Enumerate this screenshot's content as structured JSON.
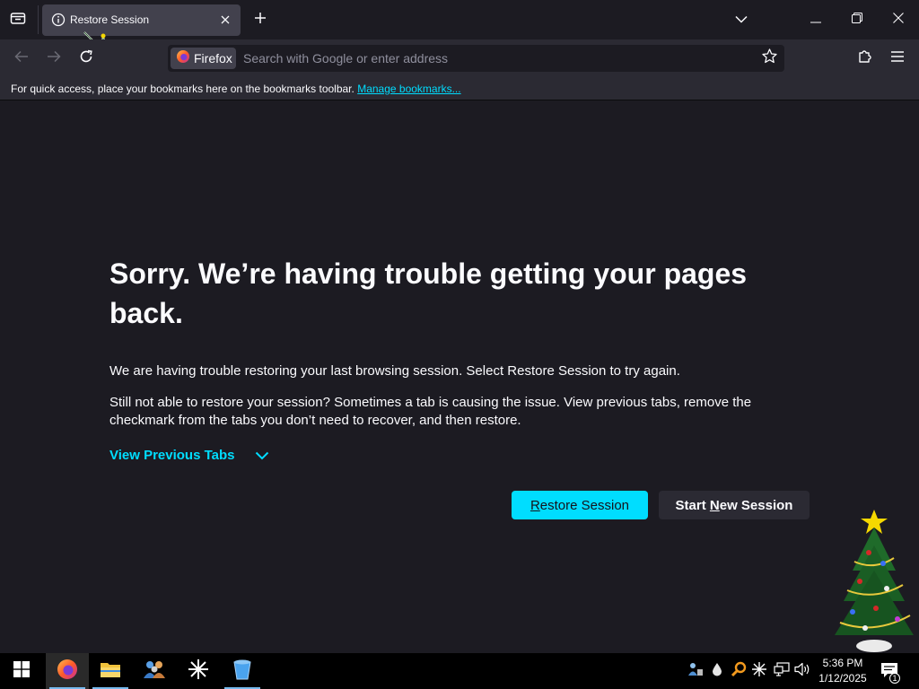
{
  "browser": {
    "tab": {
      "title": "Restore Session"
    },
    "urlbar": {
      "identity_label": "Firefox",
      "placeholder": "Search with Google or enter address",
      "value": ""
    },
    "bookmarks_bar": {
      "message": "For quick access, place your bookmarks here on the bookmarks toolbar.",
      "link": "Manage bookmarks..."
    }
  },
  "page": {
    "heading": "Sorry. We’re having trouble getting your pages back.",
    "paragraph1": "We are having trouble restoring your last browsing session. Select Restore Session to try again.",
    "paragraph2": "Still not able to restore your session? Sometimes a tab is causing the issue. View previous tabs, remove the checkmark from the tabs you don’t need to recover, and then restore.",
    "view_previous_tabs": "View Previous Tabs",
    "restore_button": {
      "prefix": "",
      "underlined": "R",
      "rest": "estore Session"
    },
    "new_session_button": {
      "prefix": "Start ",
      "underlined": "N",
      "rest": "ew Session"
    }
  },
  "taskbar": {
    "apps": [
      "start-icon",
      "firefox-icon",
      "file-explorer-icon",
      "people-icon",
      "asterisk-app-icon",
      "recycle-bin-icon"
    ],
    "tray": [
      "network-share-icon",
      "water-drop-icon",
      "search-key-icon",
      "asterisk-tray-icon",
      "network-icon",
      "volume-icon"
    ],
    "time": "5:36 PM",
    "date": "1/12/2025",
    "notification_count": "1"
  },
  "colors": {
    "accent": "#00ddff",
    "background": "#1c1b22",
    "toolbar": "#2b2a33",
    "tab_selected": "#42414d"
  }
}
